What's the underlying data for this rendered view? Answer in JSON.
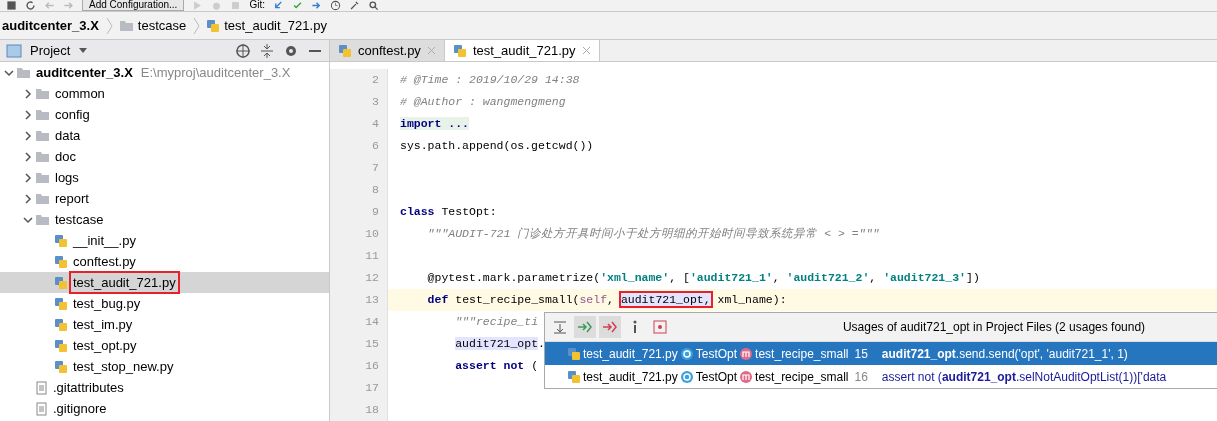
{
  "toolbar": {
    "run_config": "Add Configuration...",
    "vcs_label": "Git:"
  },
  "breadcrumbs": [
    {
      "label": "auditcenter_3.X",
      "kind": "project"
    },
    {
      "label": "testcase",
      "kind": "folder"
    },
    {
      "label": "test_audit_721.py",
      "kind": "pyfile"
    }
  ],
  "project_panel": {
    "title": "Project",
    "tree": [
      {
        "label": "auditcenter_3.X",
        "path": "E:\\myproj\\auditcenter_3.X",
        "kind": "folder",
        "expanded": true,
        "selected": false,
        "marked": false,
        "children": [
          {
            "label": "common",
            "kind": "folder",
            "expanded": false,
            "selected": false,
            "marked": false
          },
          {
            "label": "config",
            "kind": "folder",
            "expanded": false,
            "selected": false,
            "marked": false
          },
          {
            "label": "data",
            "kind": "folder",
            "expanded": false,
            "selected": false,
            "marked": false
          },
          {
            "label": "doc",
            "kind": "folder",
            "expanded": false,
            "selected": false,
            "marked": false
          },
          {
            "label": "logs",
            "kind": "folder",
            "expanded": false,
            "selected": false,
            "marked": false
          },
          {
            "label": "report",
            "kind": "folder",
            "expanded": false,
            "selected": false,
            "marked": false
          },
          {
            "label": "testcase",
            "kind": "folder",
            "expanded": true,
            "selected": false,
            "marked": false,
            "children": [
              {
                "label": "__init__.py",
                "kind": "pyfile",
                "selected": false,
                "marked": false
              },
              {
                "label": "conftest.py",
                "kind": "pyfile",
                "selected": false,
                "marked": false
              },
              {
                "label": "test_audit_721.py",
                "kind": "pyfile",
                "selected": true,
                "marked": true
              },
              {
                "label": "test_bug.py",
                "kind": "pyfile",
                "selected": false,
                "marked": false
              },
              {
                "label": "test_im.py",
                "kind": "pyfile",
                "selected": false,
                "marked": false
              },
              {
                "label": "test_opt.py",
                "kind": "pyfile",
                "selected": false,
                "marked": false
              },
              {
                "label": "test_stop_new.py",
                "kind": "pyfile",
                "selected": false,
                "marked": false
              }
            ]
          },
          {
            "label": ".gitattributes",
            "kind": "textfile",
            "selected": false,
            "marked": false
          },
          {
            "label": ".gitignore",
            "kind": "textfile",
            "selected": false,
            "marked": false
          }
        ]
      }
    ]
  },
  "editor": {
    "tabs": [
      {
        "label": "conftest.py",
        "selected": false
      },
      {
        "label": "test_audit_721.py",
        "selected": true
      }
    ],
    "lines": [
      {
        "number": "2",
        "current": false,
        "tokens": [
          {
            "t": "# @Time : 2019/10/29 14:38",
            "kind": "comment"
          }
        ]
      },
      {
        "number": "3",
        "current": false,
        "tokens": [
          {
            "t": "# @Author : wangmengmeng",
            "kind": "comment"
          }
        ]
      },
      {
        "number": "4",
        "current": false,
        "tokens": [
          {
            "t": "import ...",
            "kind": "folded"
          }
        ]
      },
      {
        "number": "6",
        "current": false,
        "tokens": [
          {
            "t": "sys.path.append(os.getcwd())",
            "kind": "plain"
          }
        ]
      },
      {
        "number": "7",
        "current": false
      },
      {
        "number": "8",
        "current": false
      },
      {
        "number": "9",
        "current": false,
        "tokens": [
          {
            "t": "class",
            "kind": "keyword"
          },
          {
            "t": " TestOpt:",
            "kind": "plain"
          }
        ]
      },
      {
        "number": "10",
        "current": false,
        "tokens": [
          {
            "t": "    \"\"\"AUDIT-721 门诊处方开具时间小于处方明细的开始时间导致系统异常 < > =\"\"\"",
            "kind": "docstring"
          }
        ]
      },
      {
        "number": "11",
        "current": false
      },
      {
        "number": "12",
        "current": false,
        "tokens": [
          {
            "t": "    @pytest.mark.parametrize(",
            "kind": "plain"
          },
          {
            "t": "'xml_name'",
            "kind": "string"
          },
          {
            "t": ", [",
            "kind": "plain"
          },
          {
            "t": "'audit721_1'",
            "kind": "string"
          },
          {
            "t": ", ",
            "kind": "plain"
          },
          {
            "t": "'audit721_2'",
            "kind": "string"
          },
          {
            "t": ", ",
            "kind": "plain"
          },
          {
            "t": "'audit721_3'",
            "kind": "string"
          },
          {
            "t": "])",
            "kind": "plain"
          }
        ]
      },
      {
        "number": "13",
        "current": true,
        "tokens": [
          {
            "t": "    def",
            "kind": "keyword"
          },
          {
            "t": " test_recipe_small(",
            "kind": "plain"
          },
          {
            "t": "self",
            "kind": "self"
          },
          {
            "t": ", ",
            "kind": "plain"
          },
          {
            "t": "audit721_opt,",
            "kind": "usage",
            "marked": true
          },
          {
            "t": " xml_name):",
            "kind": "plain"
          }
        ]
      },
      {
        "number": "14",
        "current": false,
        "tokens": [
          {
            "t": "        \"\"\"recipe_ti",
            "kind": "docstring"
          }
        ]
      },
      {
        "number": "15",
        "current": false,
        "tokens": [
          {
            "t": "        audit721_opt",
            "kind": "usage"
          },
          {
            "t": ".",
            "kind": "plain"
          }
        ]
      },
      {
        "number": "16",
        "current": false,
        "tokens": [
          {
            "t": "        assert",
            "kind": "keyword"
          },
          {
            "t": " not",
            "kind": "keyword"
          },
          {
            "t": " (",
            "kind": "plain"
          }
        ]
      },
      {
        "number": "17",
        "current": false
      },
      {
        "number": "18",
        "current": false
      }
    ]
  },
  "usages_popup": {
    "title": "Usages of audit721_opt in Project Files (2 usages found)",
    "toolbar": [
      {
        "kind": "merge",
        "on": false
      },
      {
        "kind": "read",
        "on": true
      },
      {
        "kind": "write",
        "on": true
      },
      {
        "kind": "info",
        "on": false
      },
      {
        "kind": "method",
        "on": false
      }
    ],
    "rows": [
      {
        "file": "test_audit_721.py",
        "class": "TestOpt",
        "method": "test_recipe_small",
        "line": "15",
        "code": "**audit721_opt**.send.send('opt', 'audit721_1', 1)",
        "selected": true
      },
      {
        "file": "test_audit_721.py",
        "class": "TestOpt",
        "method": "test_recipe_small",
        "line": "16",
        "code": "assert not (**audit721_opt**.selNotAuditOptList(1))['data",
        "selected": false
      }
    ]
  }
}
